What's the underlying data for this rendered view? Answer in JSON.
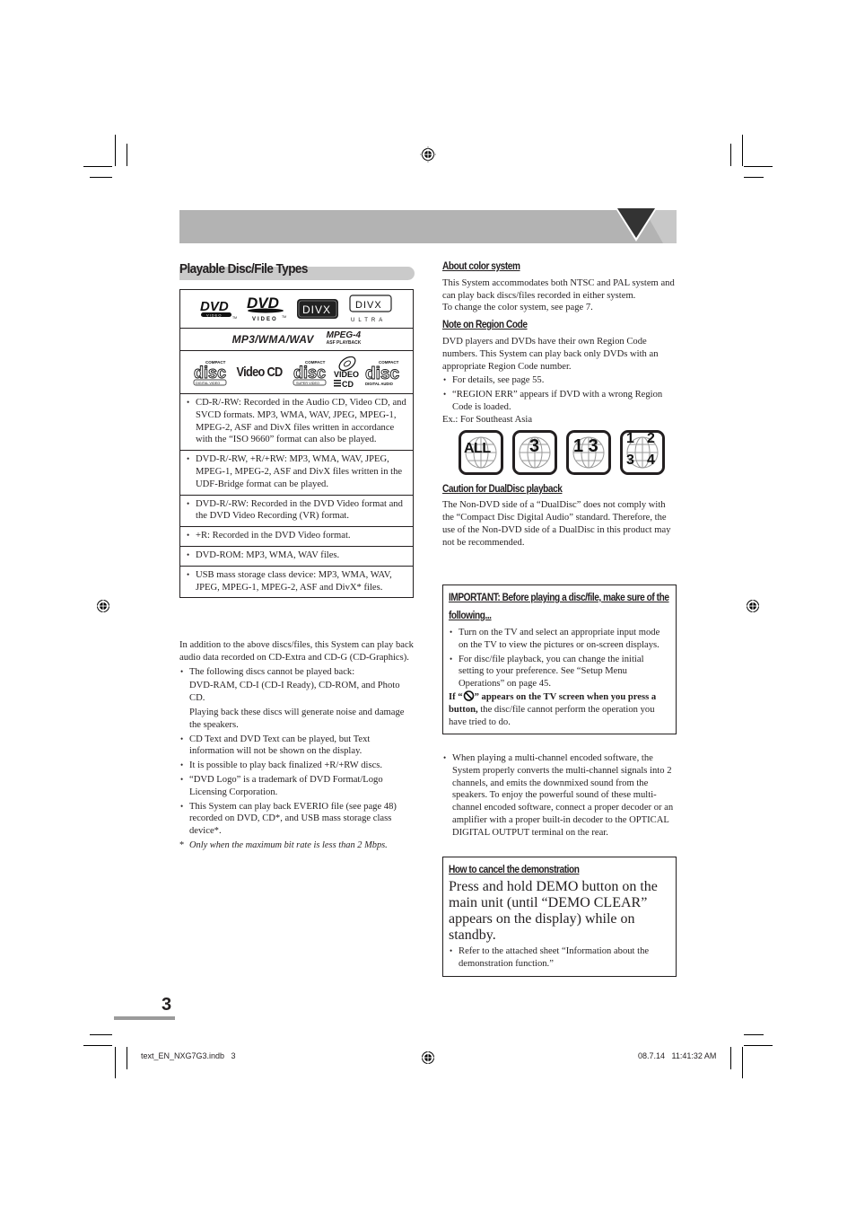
{
  "section_title": "Playable Disc/File Types",
  "logos": {
    "row1": [
      "DVD VIDEO",
      "DVD VIDEO",
      "DIVX",
      "DIVX ULTRA"
    ],
    "row2": [
      "MP3/WMA/WAV",
      "MPEG-4",
      "ASF PLAYBACK"
    ],
    "row3": [
      "COMPACT DISC DIGITAL VIDEO",
      "Video CD",
      "COMPACT DISC SUPER VIDEO",
      "VIDEO CD",
      "COMPACT DISC DIGITAL AUDIO"
    ]
  },
  "disc_types": [
    "CD-R/-RW: Recorded in the Audio CD, Video CD, and SVCD formats. MP3, WMA, WAV, JPEG, MPEG-1, MPEG-2, ASF and DivX files written in accordance with the “ISO 9660” format can also be played.",
    "DVD-R/-RW, +R/+RW: MP3, WMA, WAV, JPEG, MPEG-1, MPEG-2, ASF and DivX files written in the UDF-Bridge format can be played.",
    "DVD-R/-RW: Recorded in the DVD Video format and the DVD Video Recording (VR) format.",
    "+R: Recorded in the DVD Video format.",
    "DVD-ROM: MP3, WMA, WAV files.",
    "USB mass storage class device: MP3, WMA, WAV, JPEG, MPEG-1, MPEG-2, ASF and DivX* files."
  ],
  "left_body": {
    "intro": "In addition to the above discs/files, this System can play back audio data recorded on CD-Extra and CD-G (CD-Graphics).",
    "cannot_play_label": "The following discs cannot be played back:",
    "cannot_play_list": "DVD-RAM, CD-I (CD-I Ready), CD-ROM, and Photo CD.",
    "cannot_play_warning": "Playing back these discs will generate noise and damage the speakers.",
    "bullets": [
      "CD Text and DVD Text can be played, but Text information will not be shown on the display.",
      "It is possible to play back finalized +R/+RW discs.",
      "“DVD Logo” is a trademark of DVD Format/Logo Licensing Corporation.",
      "This System can play back EVERIO file (see page 48) recorded on DVD, CD*, and USB mass storage class device*."
    ],
    "footnote_mark": "*",
    "footnote": "Only when the maximum bit rate is less than 2 Mbps."
  },
  "color_system": {
    "heading": "About color system",
    "body": "This System accommodates both NTSC and PAL system and can play back discs/files recorded in either system.",
    "body2": "To change the color system, see page 7."
  },
  "region_code": {
    "heading": "Note on Region Code",
    "body": "DVD players and DVDs have their own Region Code numbers. This System can play back only DVDs with an appropriate Region Code number.",
    "bullets": [
      "For details, see page 55.",
      "“REGION ERR” appears if DVD with a wrong Region Code is loaded."
    ],
    "example": "Ex.: For Southeast Asia",
    "icons": [
      "ALL",
      "3",
      "1 3",
      "1 2 3 4"
    ]
  },
  "dualdisc": {
    "heading": "Caution for DualDisc playback",
    "body": "The Non-DVD side of a “DualDisc” does not comply with the “Compact Disc Digital Audio” standard. Therefore, the use of the Non-DVD side of a DualDisc in this product may not be recommended."
  },
  "important": {
    "heading": "IMPORTANT: Before playing a disc/file, make sure of the following...",
    "bullets": [
      "Turn on the TV and select an appropriate input mode on the TV to view the pictures or on-screen displays.",
      "For disc/file playback, you can change the initial setting to your preference. See “Setup Menu Operations” on page 45."
    ],
    "note_bold_1": "If “",
    "note_bold_2": "” appears on the TV screen when you press a button,",
    "note_rest": " the disc/file cannot perform the operation you have tried to do."
  },
  "multichannel": "When playing a multi-channel encoded software, the System properly converts the multi-channel signals into 2 channels, and emits the downmixed sound from the speakers. To enjoy the powerful sound of these multi-channel encoded software, connect a proper decoder or an amplifier with a proper built-in decoder to the OPTICAL DIGITAL OUTPUT terminal on the rear.",
  "demo": {
    "heading": "How to cancel the demonstration",
    "body": "Press and hold DEMO button on the main unit (until “DEMO CLEAR” appears on the display) while on standby.",
    "bullet": "Refer to the attached sheet “Information about the demonstration function.”"
  },
  "page_number": "3",
  "slug": {
    "file": "text_EN_NXG7G3.indb   3",
    "datetime": "08.7.14   11:41:32 AM"
  },
  "bullet_char": "•"
}
